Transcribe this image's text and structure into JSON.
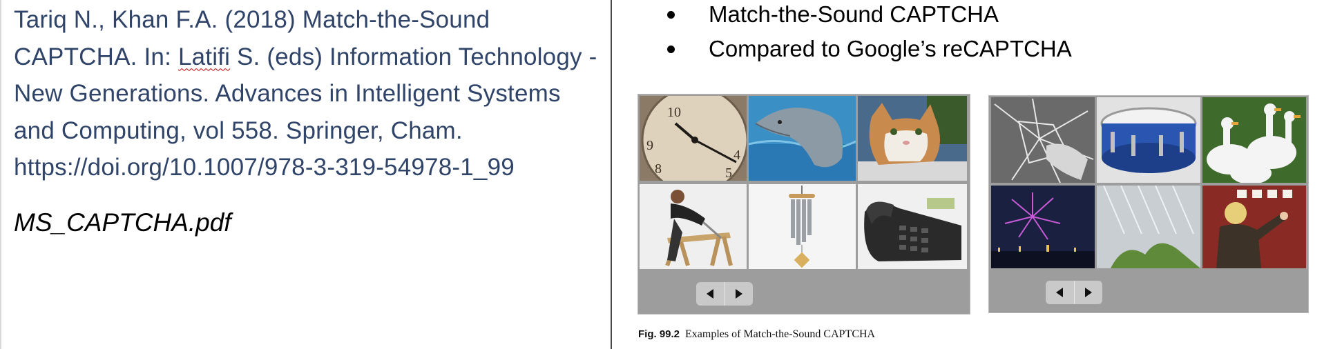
{
  "citation": {
    "before_link": "Tariq N., Khan F.A. (2018) Match-the-Sound CAPTCHA. In: ",
    "misspelled_word": "Latifi",
    "after_link": " S. (eds) Information Technology - New Generations. Advances in Intelligent Systems and Computing, vol 558. Springer, Cham.",
    "doi": "https://doi.org/10.1007/978-3-319-54978-1_99"
  },
  "file_name": "MS_CAPTCHA.pdf",
  "bullets": [
    "Match-the-Sound CAPTCHA",
    "Compared to Google’s reCAPTCHA"
  ],
  "figure": {
    "label": "Fig. 99.2",
    "text": "Examples of Match-the-Sound CAPTCHA",
    "panel_1_images": [
      "clock",
      "dolphin",
      "cat",
      "man-sawing-wood",
      "wind-chime",
      "telephone"
    ],
    "panel_2_images": [
      "breaking-glass",
      "drum",
      "geese",
      "fireworks",
      "rain",
      "woman-knocking-door"
    ]
  },
  "colors": {
    "citation_text": "#2f4468",
    "panel_background": "#9d9d9d",
    "divider": "#4a4a4a"
  }
}
